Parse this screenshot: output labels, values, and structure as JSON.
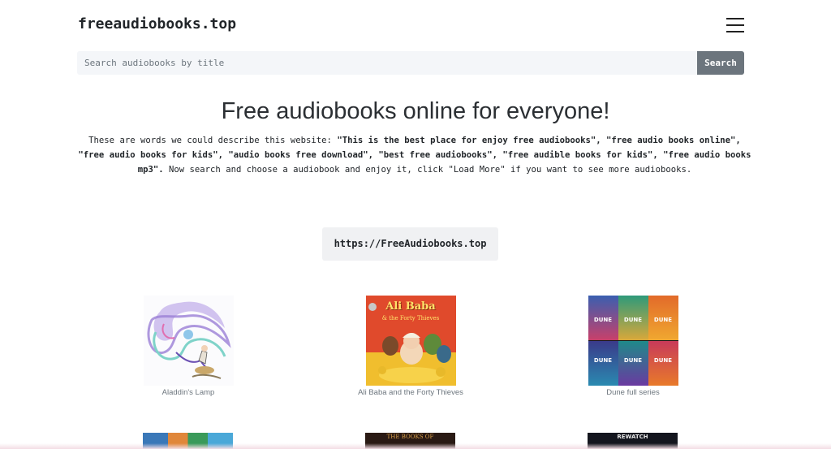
{
  "site": {
    "brand": "freeaudiobooks.top"
  },
  "search": {
    "placeholder": "Search audiobooks by title",
    "value": "",
    "button_label": "Search"
  },
  "hero": {
    "title": "Free audiobooks online for everyone!",
    "desc_intro": "These are words we could describe this website: ",
    "desc_keywords": "\"This is the best place for enjoy free audiobooks\", \"free audio books online\", \"free audio books for kids\", \"audio books free download\", \"best free audiobooks\", \"free audible books for kids\", \"free audio books mp3\".",
    "desc_outro": " Now search and choose a audiobook and enjoy it, click \"Load More\" if you want to see more audiobooks."
  },
  "url_box": "https://FreeAudiobooks.top",
  "books": [
    {
      "title": "Aladdin's Lamp",
      "cover_text": []
    },
    {
      "title": "Ali Baba and the Forty Thieves",
      "cover_text": [
        "Ali Baba",
        "& the Forty Thieves"
      ]
    },
    {
      "title": "Dune full series",
      "cover_text": [
        "DUNE",
        "DUNE",
        "DUNE",
        "DUNE",
        "DUNE",
        "DUNE"
      ]
    }
  ],
  "bottom_covers": [
    {
      "cover_text": ""
    },
    {
      "cover_text": "THE BOOKS OF"
    },
    {
      "cover_text": "REWATCH"
    }
  ],
  "colors": {
    "search_button": "#6c757d",
    "search_bg": "#f4f6f9",
    "url_box_bg": "#f0f1f3",
    "book_title": "#6c757d"
  }
}
